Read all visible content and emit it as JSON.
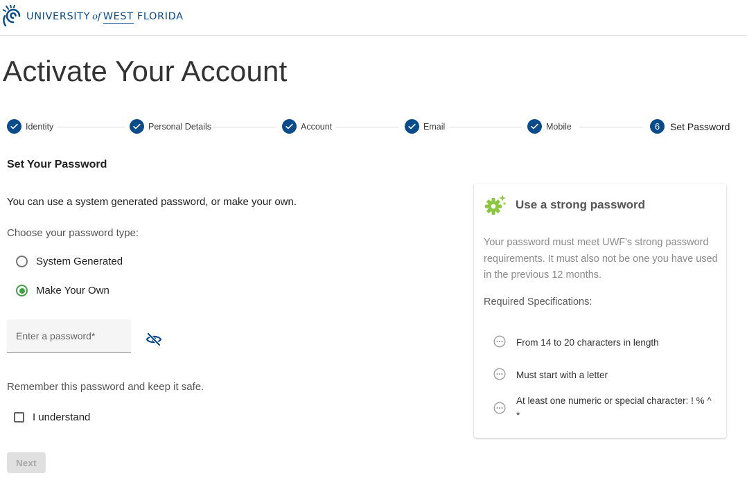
{
  "header": {
    "logo": {
      "word1": "UNIVERSITY",
      "word2": "of",
      "word3": "WEST",
      "word4": "FLORIDA",
      "icon": "uwf-swirl-logo",
      "color": "#0a4b8c"
    }
  },
  "page_title": "Activate Your Account",
  "stepper": {
    "steps": [
      {
        "label": "Identity",
        "state": "complete"
      },
      {
        "label": "Personal Details",
        "state": "complete"
      },
      {
        "label": "Account",
        "state": "complete"
      },
      {
        "label": "Email",
        "state": "complete"
      },
      {
        "label": "Mobile",
        "state": "complete"
      },
      {
        "label": "Set Password",
        "state": "active",
        "number": "6"
      }
    ],
    "accent": "#0a4b8c"
  },
  "form": {
    "section_title": "Set Your Password",
    "intro": "You can use a system generated password, or make your own.",
    "choose_label": "Choose your password type:",
    "options": [
      {
        "label": "System Generated",
        "checked": false
      },
      {
        "label": "Make Your Own",
        "checked": true
      }
    ],
    "password": {
      "placeholder": "Enter a password*",
      "value": ""
    },
    "remember_text": "Remember this password and keep it safe.",
    "understand_label": "I understand",
    "next_label": "Next"
  },
  "card": {
    "title": "Use a strong password",
    "icon": "gear-sparkle-icon",
    "icon_color": "#8cc63f",
    "description": "Your password must meet UWF's strong password requirements. It must also not be one you have used in the previous 12 months.",
    "required_label": "Required Specifications:",
    "specs": [
      "From 14 to 20 characters in length",
      "Must start with a letter",
      "At least one numeric or special character: ! % ^ *"
    ]
  }
}
